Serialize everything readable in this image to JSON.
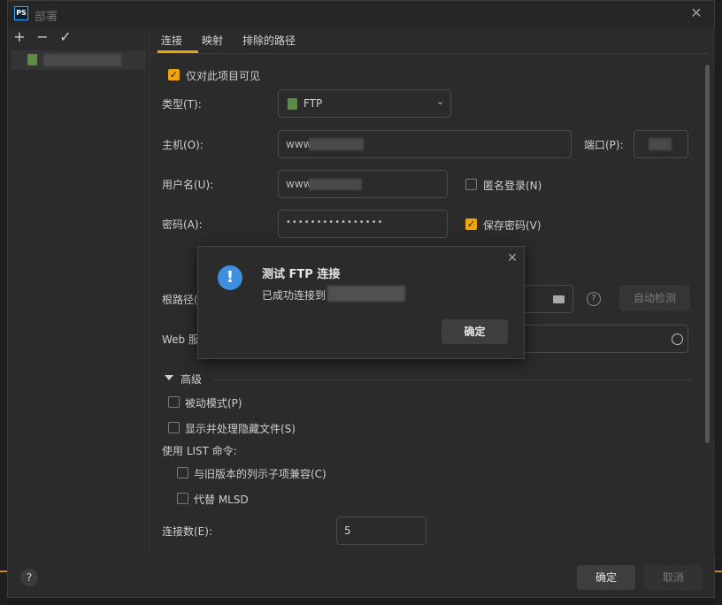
{
  "window": {
    "title": "部署",
    "close_icon": "close-icon"
  },
  "toolbar": {
    "add_label": "+",
    "remove_label": "−",
    "apply_label": "✓"
  },
  "tabs": [
    {
      "label": "连接"
    },
    {
      "label": "映射"
    },
    {
      "label": "排除的路径"
    }
  ],
  "form": {
    "visible_only_label": "仅对此项目可见",
    "type_label": "类型(T):",
    "type_value": "FTP",
    "host_label": "主机(O):",
    "host_value": "www",
    "port_label": "端口(P):",
    "user_label": "用户名(U):",
    "user_value": "www",
    "anon_label": "匿名登录(N)",
    "pwd_label": "密码(A):",
    "pwd_value": "••••••••••••••••",
    "save_pwd_label": "保存密码(V)",
    "root_label": "根路径(",
    "autodetect_label": "自动检测",
    "web_label": "Web 服",
    "advanced_label": "高级",
    "passive_label": "被动模式(P)",
    "hidden_label": "显示并处理隐藏文件(S)",
    "list_label": "使用  LIST 命令:",
    "compat_label": "与旧版本的列示子项兼容(C)",
    "mlsd_label": "代替 MLSD",
    "conn_label": "连接数(E):",
    "conn_value": "5"
  },
  "dialog": {
    "title": "测试 FTP 连接",
    "message": "已成功连接到",
    "ok_label": "确定"
  },
  "footer": {
    "help_label": "?",
    "ok_label": "确定",
    "cancel_label": "取消"
  }
}
